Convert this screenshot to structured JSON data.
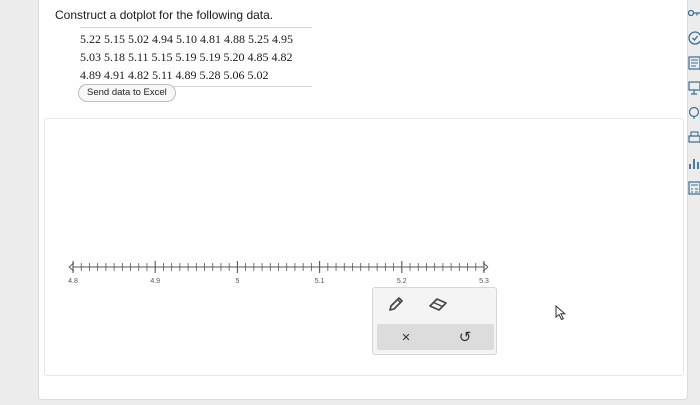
{
  "question": {
    "prompt": "Construct a dotplot for the following data.",
    "data_lines": [
      "5.22 5.15 5.02 4.94 5.10 4.81 4.88 5.25 4.95",
      "5.03 5.18 5.11 5.15 5.19 5.19 5.20 4.85 4.82",
      "4.89 4.91 4.82 5.11 4.89 5.28 5.06 5.02"
    ],
    "excel_button": "Send data to Excel"
  },
  "axis": {
    "min": 4.8,
    "max": 5.3,
    "minor_step": 0.01,
    "tick_labels": [
      "4.8",
      "4.9",
      "5",
      "5.1",
      "5.2",
      "5.3"
    ]
  },
  "toolbox": {
    "tools": [
      "pencil-icon",
      "eraser-icon"
    ],
    "clear_label": "×",
    "undo_label": "↺"
  },
  "sidebar": {
    "icons": [
      "key-icon",
      "check-circle-icon",
      "text-list-icon",
      "textbook-icon",
      "hint-icon",
      "print-icon",
      "chart-icon",
      "calculator-icon"
    ]
  }
}
